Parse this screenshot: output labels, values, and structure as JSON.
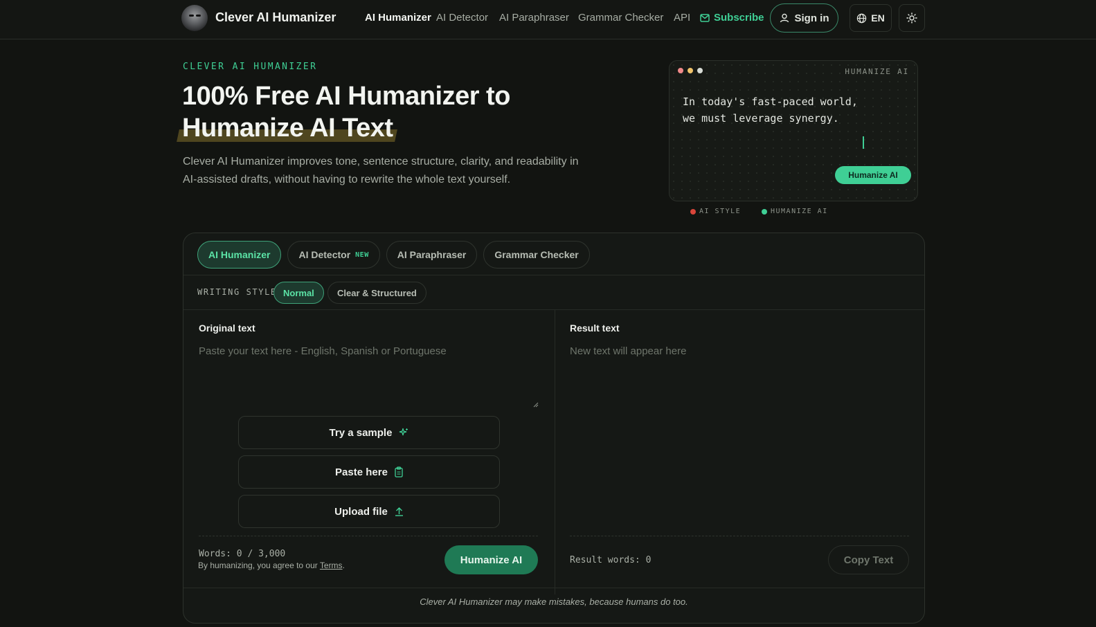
{
  "nav": {
    "brand": "Clever AI Humanizer",
    "links": [
      "AI Humanizer",
      "AI Detector",
      "AI Paraphraser",
      "Grammar Checker",
      "API"
    ],
    "subscribe": "Subscribe",
    "sign_in": "Sign in",
    "language": "EN"
  },
  "hero": {
    "eyebrow": "CLEVER AI HUMANIZER",
    "title_line1": "100% Free AI Humanizer to",
    "title_line2": "Humanize AI Text",
    "subtitle": "Clever AI Humanizer improves tone, sentence structure, clarity, and readability in AI-assisted drafts, without having to rewrite the whole text yourself."
  },
  "demo": {
    "label": "HUMANIZE AI",
    "text": "In today's fast-paced world,\nwe must leverage synergy.",
    "button": "Humanize AI",
    "legend": [
      {
        "label": "AI STYLE",
        "color": "#d9453a"
      },
      {
        "label": "HUMANIZE AI",
        "color": "#3fcf95"
      }
    ],
    "window_dots": [
      "#f08a8a",
      "#f0c36b",
      "#d8dcd6"
    ]
  },
  "tool": {
    "tabs": [
      {
        "label": "AI Humanizer",
        "badge": ""
      },
      {
        "label": "AI Detector",
        "badge": "NEW"
      },
      {
        "label": "AI Paraphraser",
        "badge": ""
      },
      {
        "label": "Grammar Checker",
        "badge": ""
      }
    ],
    "writing_style": {
      "label": "WRITING STYLE",
      "options": [
        "Normal",
        "Clear & Structured"
      ],
      "selected": "Normal"
    },
    "original": {
      "title": "Original text",
      "placeholder": "Paste your text here - English, Spanish or Portuguese",
      "actions": [
        "Try a sample",
        "Paste here",
        "Upload file"
      ],
      "words": "Words: 0 / 3,000",
      "terms_prefix": "By humanizing, you agree to our ",
      "terms_link": "Terms",
      "terms_suffix": ".",
      "submit": "Humanize AI"
    },
    "result": {
      "title": "Result text",
      "placeholder": "New text will appear here",
      "words": "Result words: 0",
      "copy": "Copy Text"
    },
    "disclaimer": "Clever AI Humanizer may make mistakes, because humans do too."
  },
  "colors": {
    "accent": "#3fcf95",
    "background": "#121411",
    "button_green": "#1f7a55"
  }
}
